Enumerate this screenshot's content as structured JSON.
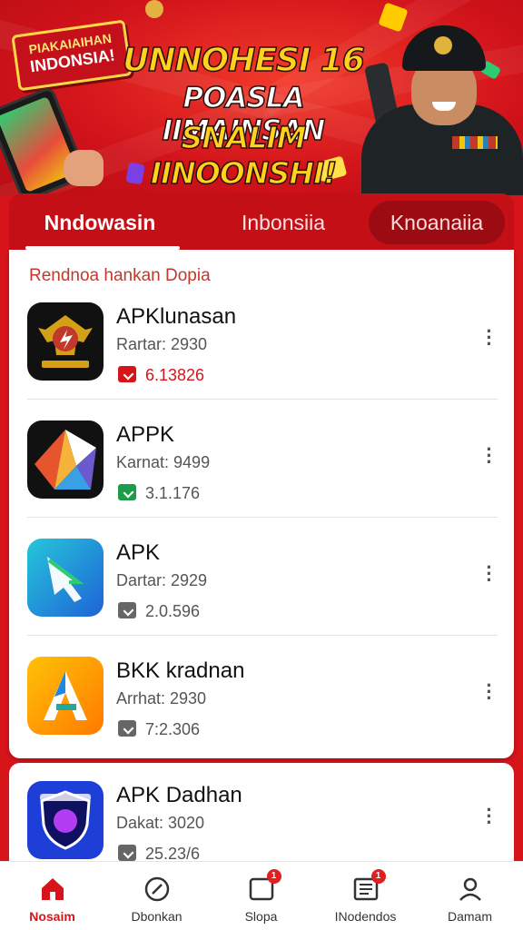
{
  "banner": {
    "tag_line1": "PIAKAIAIHAN",
    "tag_line2": "INDONSIA!",
    "headline1": "UNNOHESI 16",
    "headline2": "POASLA IIMAINSAN",
    "headline3": "SNALIM IINOONSHI!"
  },
  "tabs": [
    {
      "label": "Nndowasin",
      "active": true
    },
    {
      "label": "Inbonsiia",
      "active": false
    },
    {
      "label": "Knoanaiia",
      "active": false
    }
  ],
  "section": {
    "title": "Rendnoa hankan Dopia"
  },
  "apps": [
    {
      "name": "APKlunasan",
      "category": "Rartar: 2930",
      "downloads": "6.13826",
      "dl_color": "#d7141a",
      "icon": "garuda-emblem-icon",
      "colors": [
        "#111111",
        "#d4a017"
      ]
    },
    {
      "name": "APPK",
      "category": "Karnat: 9499",
      "downloads": "3.1.176",
      "dl_color": "#1e9c4a",
      "icon": "colorful-star-icon",
      "colors": [
        "#111111",
        "#e6552e"
      ]
    },
    {
      "name": "APK",
      "category": "Dartar: 2929",
      "downloads": "2.0.596",
      "dl_color": "#666666",
      "icon": "blue-arrow-icon",
      "colors": [
        "#1e88e5",
        "#26c6da"
      ]
    },
    {
      "name": "BKK kradnan",
      "category": "Arrhat: 2930",
      "downloads": "7:2.306",
      "dl_color": "#666666",
      "icon": "letter-a-icon",
      "colors": [
        "#ffb300",
        "#ff6f00"
      ]
    },
    {
      "name": "APK Dadhan",
      "category": "Dakat: 3020",
      "downloads": "25.23/6",
      "dl_color": "#666666",
      "icon": "shield-badge-icon",
      "colors": [
        "#1d3fd8",
        "#101060"
      ]
    }
  ],
  "nav": [
    {
      "label": "Nosaim",
      "icon": "home-icon",
      "active": true,
      "badge": ""
    },
    {
      "label": "Dbonkan",
      "icon": "compass-icon",
      "active": false,
      "badge": ""
    },
    {
      "label": "Slopa",
      "icon": "message-icon",
      "active": false,
      "badge": "1"
    },
    {
      "label": "INodendos",
      "icon": "news-icon",
      "active": false,
      "badge": "1"
    },
    {
      "label": "Damam",
      "icon": "profile-icon",
      "active": false,
      "badge": ""
    }
  ],
  "colors": {
    "primary": "#d7141a",
    "headline_yellow": "#ffd21f"
  }
}
